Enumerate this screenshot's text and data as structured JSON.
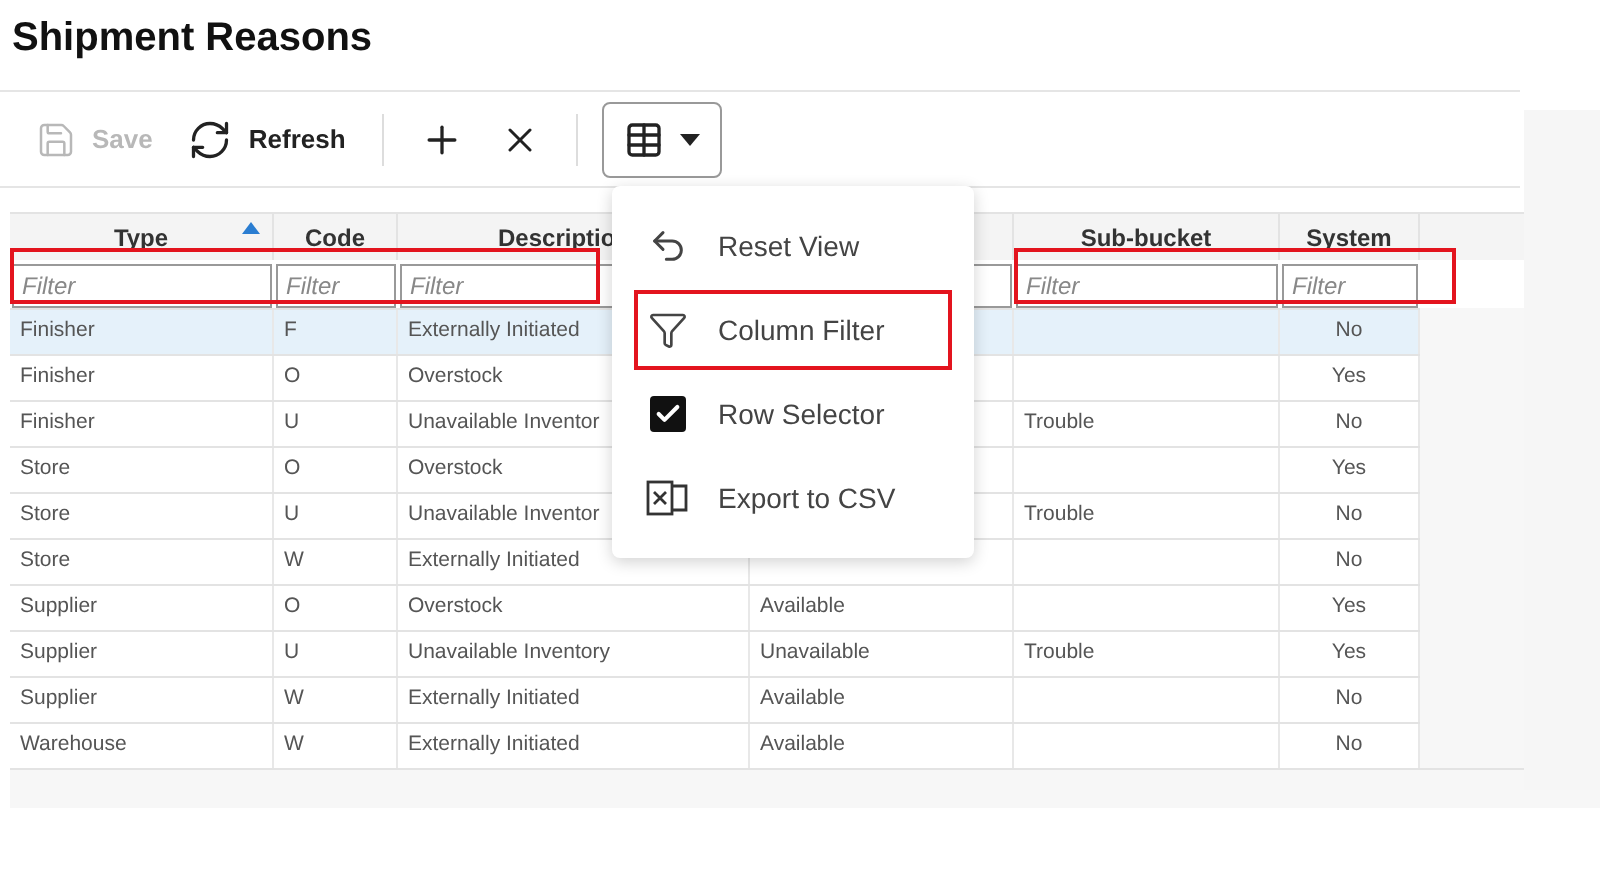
{
  "title": "Shipment Reasons",
  "toolbar": [
    {
      "kind": "save",
      "label": "Save",
      "disabled": true
    },
    {
      "kind": "refresh",
      "label": "Refresh",
      "disabled": false
    },
    {
      "kind": "add",
      "disabled": false
    },
    {
      "kind": "delete",
      "disabled": false
    },
    {
      "kind": "view",
      "expanded": true,
      "disabled": false
    }
  ],
  "table": {
    "columns": [
      {
        "label": "Type",
        "sorted_ascending": true,
        "placeholder": "Filter",
        "highlighted": true
      },
      {
        "label": "Code",
        "placeholder": "Filter",
        "highlighted": true
      },
      {
        "label": "Descriptio",
        "placeholder": "Filter",
        "highlighted": true
      },
      {
        "highlighted": false
      },
      {
        "label": "Sub-bucket",
        "placeholder": "Filter",
        "highlighted": true
      },
      {
        "label": "System",
        "placeholder": "Filter",
        "highlighted": true
      }
    ],
    "rows": [
      {
        "selected": true,
        "cells": [
          "Finisher",
          "F",
          "Externally Initiated",
          null,
          "",
          "No"
        ]
      },
      {
        "selected": false,
        "cells": [
          "Finisher",
          "O",
          "Overstock",
          null,
          "",
          "Yes"
        ]
      },
      {
        "selected": false,
        "cells": [
          "Finisher",
          "U",
          "Unavailable Inventor",
          null,
          "Trouble",
          "No"
        ]
      },
      {
        "selected": false,
        "cells": [
          "Store",
          "O",
          "Overstock",
          null,
          "",
          "Yes"
        ]
      },
      {
        "selected": false,
        "cells": [
          "Store",
          "U",
          "Unavailable Inventor",
          null,
          "Trouble",
          "No"
        ]
      },
      {
        "selected": false,
        "cells": [
          "Store",
          "W",
          "Externally Initiated",
          null,
          "",
          "No"
        ]
      },
      {
        "selected": false,
        "cells": [
          "Supplier",
          "O",
          "Overstock",
          "Available",
          "",
          "Yes"
        ]
      },
      {
        "selected": false,
        "cells": [
          "Supplier",
          "U",
          "Unavailable Inventory",
          "Unavailable",
          "Trouble",
          "Yes"
        ]
      },
      {
        "selected": false,
        "cells": [
          "Supplier",
          "W",
          "Externally Initiated",
          "Available",
          "",
          "No"
        ]
      },
      {
        "selected": false,
        "cells": [
          "Warehouse",
          "W",
          "Externally Initiated",
          "Available",
          "",
          "No"
        ]
      }
    ]
  },
  "menu": {
    "items": [
      {
        "kind": "reset",
        "label": "Reset View",
        "highlighted": false
      },
      {
        "kind": "filter",
        "label": "Column Filter",
        "highlighted": true
      },
      {
        "kind": "checkbox",
        "label": "Row Selector",
        "checked": true,
        "highlighted": false
      },
      {
        "kind": "export",
        "label": "Export to CSV",
        "highlighted": false
      }
    ]
  }
}
